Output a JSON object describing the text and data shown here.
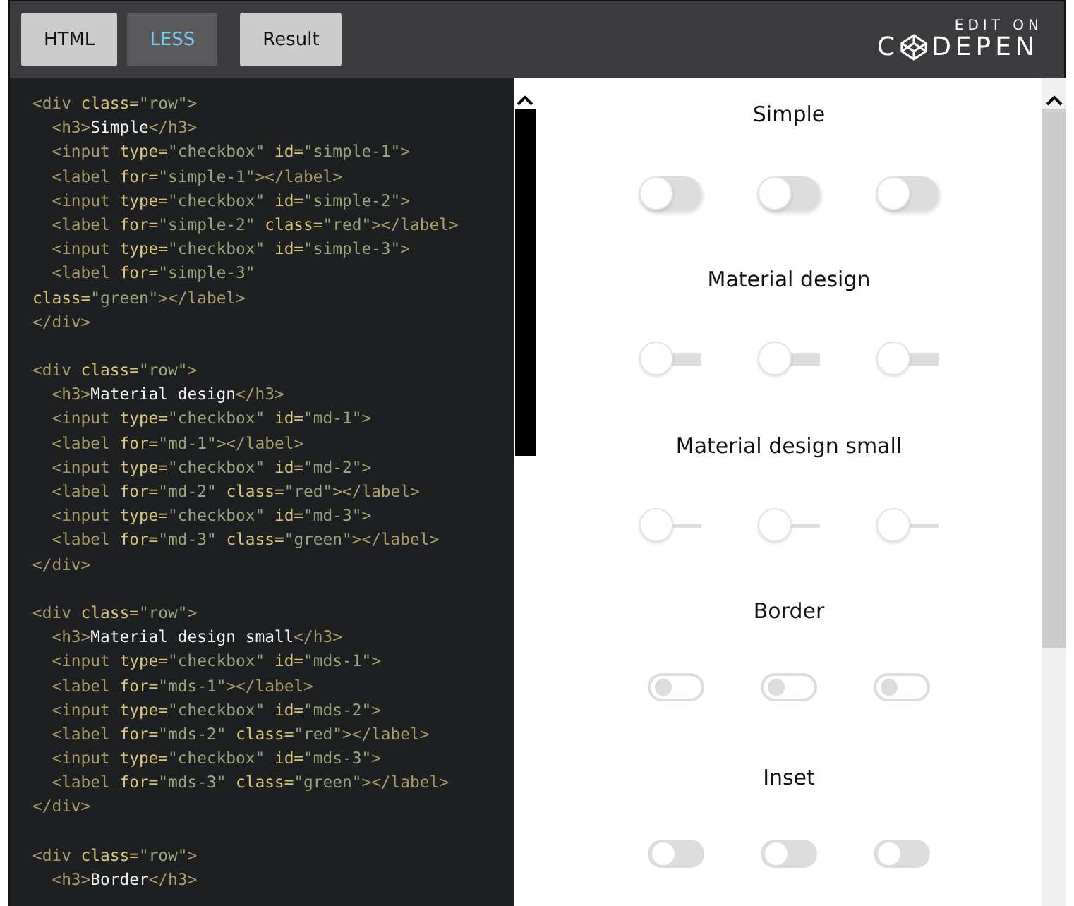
{
  "tabs": [
    {
      "label": "HTML",
      "selected": false
    },
    {
      "label": "LESS",
      "selected": true
    },
    {
      "label": "Result",
      "selected": false
    }
  ],
  "logo": {
    "caption": "EDIT ON",
    "before": "C",
    "after": "DEPEN"
  },
  "code_blocks": [
    [
      [
        {
          "kind": "tag",
          "text": "<div "
        },
        {
          "kind": "attr",
          "text": "class="
        },
        {
          "kind": "string",
          "text": "\"row\""
        },
        {
          "kind": "tag",
          "text": ">"
        }
      ],
      [
        {
          "kind": "tag",
          "text": "  <h3>"
        },
        {
          "kind": "text",
          "text": "Simple"
        },
        {
          "kind": "tag",
          "text": "</h3>"
        }
      ],
      [
        {
          "kind": "tag",
          "text": "  <input "
        },
        {
          "kind": "attr",
          "text": "type="
        },
        {
          "kind": "string",
          "text": "\"checkbox\" "
        },
        {
          "kind": "attr",
          "text": "id="
        },
        {
          "kind": "string",
          "text": "\"simple-1\""
        },
        {
          "kind": "tag",
          "text": ">"
        }
      ],
      [
        {
          "kind": "tag",
          "text": "  <label "
        },
        {
          "kind": "attr",
          "text": "for="
        },
        {
          "kind": "string",
          "text": "\"simple-1\""
        },
        {
          "kind": "tag",
          "text": "></label>"
        }
      ],
      [
        {
          "kind": "tag",
          "text": "  <input "
        },
        {
          "kind": "attr",
          "text": "type="
        },
        {
          "kind": "string",
          "text": "\"checkbox\" "
        },
        {
          "kind": "attr",
          "text": "id="
        },
        {
          "kind": "string",
          "text": "\"simple-2\""
        },
        {
          "kind": "tag",
          "text": ">"
        }
      ],
      [
        {
          "kind": "tag",
          "text": "  <label "
        },
        {
          "kind": "attr",
          "text": "for="
        },
        {
          "kind": "string",
          "text": "\"simple-2\" "
        },
        {
          "kind": "attr",
          "text": "class="
        },
        {
          "kind": "string",
          "text": "\"red\""
        },
        {
          "kind": "tag",
          "text": "></label>"
        }
      ],
      [
        {
          "kind": "tag",
          "text": "  <input "
        },
        {
          "kind": "attr",
          "text": "type="
        },
        {
          "kind": "string",
          "text": "\"checkbox\" "
        },
        {
          "kind": "attr",
          "text": "id="
        },
        {
          "kind": "string",
          "text": "\"simple-3\""
        },
        {
          "kind": "tag",
          "text": ">"
        }
      ],
      [
        {
          "kind": "tag",
          "text": "  <label "
        },
        {
          "kind": "attr",
          "text": "for="
        },
        {
          "kind": "string",
          "text": "\"simple-3\""
        }
      ],
      [
        {
          "kind": "attr",
          "text": "class="
        },
        {
          "kind": "string",
          "text": "\"green\""
        },
        {
          "kind": "tag",
          "text": "></label>"
        }
      ],
      [
        {
          "kind": "tag",
          "text": "</div>"
        }
      ]
    ],
    [
      [
        {
          "kind": "tag",
          "text": "<div "
        },
        {
          "kind": "attr",
          "text": "class="
        },
        {
          "kind": "string",
          "text": "\"row\""
        },
        {
          "kind": "tag",
          "text": ">"
        }
      ],
      [
        {
          "kind": "tag",
          "text": "  <h3>"
        },
        {
          "kind": "text",
          "text": "Material design"
        },
        {
          "kind": "tag",
          "text": "</h3>"
        }
      ],
      [
        {
          "kind": "tag",
          "text": "  <input "
        },
        {
          "kind": "attr",
          "text": "type="
        },
        {
          "kind": "string",
          "text": "\"checkbox\" "
        },
        {
          "kind": "attr",
          "text": "id="
        },
        {
          "kind": "string",
          "text": "\"md-1\""
        },
        {
          "kind": "tag",
          "text": ">"
        }
      ],
      [
        {
          "kind": "tag",
          "text": "  <label "
        },
        {
          "kind": "attr",
          "text": "for="
        },
        {
          "kind": "string",
          "text": "\"md-1\""
        },
        {
          "kind": "tag",
          "text": "></label>"
        }
      ],
      [
        {
          "kind": "tag",
          "text": "  <input "
        },
        {
          "kind": "attr",
          "text": "type="
        },
        {
          "kind": "string",
          "text": "\"checkbox\" "
        },
        {
          "kind": "attr",
          "text": "id="
        },
        {
          "kind": "string",
          "text": "\"md-2\""
        },
        {
          "kind": "tag",
          "text": ">"
        }
      ],
      [
        {
          "kind": "tag",
          "text": "  <label "
        },
        {
          "kind": "attr",
          "text": "for="
        },
        {
          "kind": "string",
          "text": "\"md-2\" "
        },
        {
          "kind": "attr",
          "text": "class="
        },
        {
          "kind": "string",
          "text": "\"red\""
        },
        {
          "kind": "tag",
          "text": "></label>"
        }
      ],
      [
        {
          "kind": "tag",
          "text": "  <input "
        },
        {
          "kind": "attr",
          "text": "type="
        },
        {
          "kind": "string",
          "text": "\"checkbox\" "
        },
        {
          "kind": "attr",
          "text": "id="
        },
        {
          "kind": "string",
          "text": "\"md-3\""
        },
        {
          "kind": "tag",
          "text": ">"
        }
      ],
      [
        {
          "kind": "tag",
          "text": "  <label "
        },
        {
          "kind": "attr",
          "text": "for="
        },
        {
          "kind": "string",
          "text": "\"md-3\" "
        },
        {
          "kind": "attr",
          "text": "class="
        },
        {
          "kind": "string",
          "text": "\"green\""
        },
        {
          "kind": "tag",
          "text": "></label>"
        }
      ],
      [
        {
          "kind": "tag",
          "text": "</div>"
        }
      ]
    ],
    [
      [
        {
          "kind": "tag",
          "text": "<div "
        },
        {
          "kind": "attr",
          "text": "class="
        },
        {
          "kind": "string",
          "text": "\"row\""
        },
        {
          "kind": "tag",
          "text": ">"
        }
      ],
      [
        {
          "kind": "tag",
          "text": "  <h3>"
        },
        {
          "kind": "text",
          "text": "Material design small"
        },
        {
          "kind": "tag",
          "text": "</h3>"
        }
      ],
      [
        {
          "kind": "tag",
          "text": "  <input "
        },
        {
          "kind": "attr",
          "text": "type="
        },
        {
          "kind": "string",
          "text": "\"checkbox\" "
        },
        {
          "kind": "attr",
          "text": "id="
        },
        {
          "kind": "string",
          "text": "\"mds-1\""
        },
        {
          "kind": "tag",
          "text": ">"
        }
      ],
      [
        {
          "kind": "tag",
          "text": "  <label "
        },
        {
          "kind": "attr",
          "text": "for="
        },
        {
          "kind": "string",
          "text": "\"mds-1\""
        },
        {
          "kind": "tag",
          "text": "></label>"
        }
      ],
      [
        {
          "kind": "tag",
          "text": "  <input "
        },
        {
          "kind": "attr",
          "text": "type="
        },
        {
          "kind": "string",
          "text": "\"checkbox\" "
        },
        {
          "kind": "attr",
          "text": "id="
        },
        {
          "kind": "string",
          "text": "\"mds-2\""
        },
        {
          "kind": "tag",
          "text": ">"
        }
      ],
      [
        {
          "kind": "tag",
          "text": "  <label "
        },
        {
          "kind": "attr",
          "text": "for="
        },
        {
          "kind": "string",
          "text": "\"mds-2\" "
        },
        {
          "kind": "attr",
          "text": "class="
        },
        {
          "kind": "string",
          "text": "\"red\""
        },
        {
          "kind": "tag",
          "text": "></label>"
        }
      ],
      [
        {
          "kind": "tag",
          "text": "  <input "
        },
        {
          "kind": "attr",
          "text": "type="
        },
        {
          "kind": "string",
          "text": "\"checkbox\" "
        },
        {
          "kind": "attr",
          "text": "id="
        },
        {
          "kind": "string",
          "text": "\"mds-3\""
        },
        {
          "kind": "tag",
          "text": ">"
        }
      ],
      [
        {
          "kind": "tag",
          "text": "  <label "
        },
        {
          "kind": "attr",
          "text": "for="
        },
        {
          "kind": "string",
          "text": "\"mds-3\" "
        },
        {
          "kind": "attr",
          "text": "class="
        },
        {
          "kind": "string",
          "text": "\"green\""
        },
        {
          "kind": "tag",
          "text": "></label>"
        }
      ],
      [
        {
          "kind": "tag",
          "text": "</div>"
        }
      ]
    ],
    [
      [
        {
          "kind": "tag",
          "text": "<div "
        },
        {
          "kind": "attr",
          "text": "class="
        },
        {
          "kind": "string",
          "text": "\"row\""
        },
        {
          "kind": "tag",
          "text": ">"
        }
      ],
      [
        {
          "kind": "tag",
          "text": "  <h3>"
        },
        {
          "kind": "text",
          "text": "Border"
        },
        {
          "kind": "tag",
          "text": "</h3>"
        }
      ]
    ]
  ],
  "sections": [
    {
      "title": "Simple",
      "kind": "simple",
      "toggles": [
        {
          "checked": false
        },
        {
          "checked": false
        },
        {
          "checked": false
        }
      ]
    },
    {
      "title": "Material design",
      "kind": "material",
      "toggles": [
        {
          "checked": false
        },
        {
          "checked": false
        },
        {
          "checked": false
        }
      ]
    },
    {
      "title": "Material design small",
      "kind": "material-small",
      "toggles": [
        {
          "checked": false
        },
        {
          "checked": false
        },
        {
          "checked": false
        }
      ]
    },
    {
      "title": "Border",
      "kind": "border",
      "toggles": [
        {
          "checked": false
        },
        {
          "checked": false
        },
        {
          "checked": false
        }
      ]
    },
    {
      "title": "Inset",
      "kind": "inset",
      "toggles": [
        {
          "checked": false
        },
        {
          "checked": false
        },
        {
          "checked": false
        }
      ]
    }
  ]
}
